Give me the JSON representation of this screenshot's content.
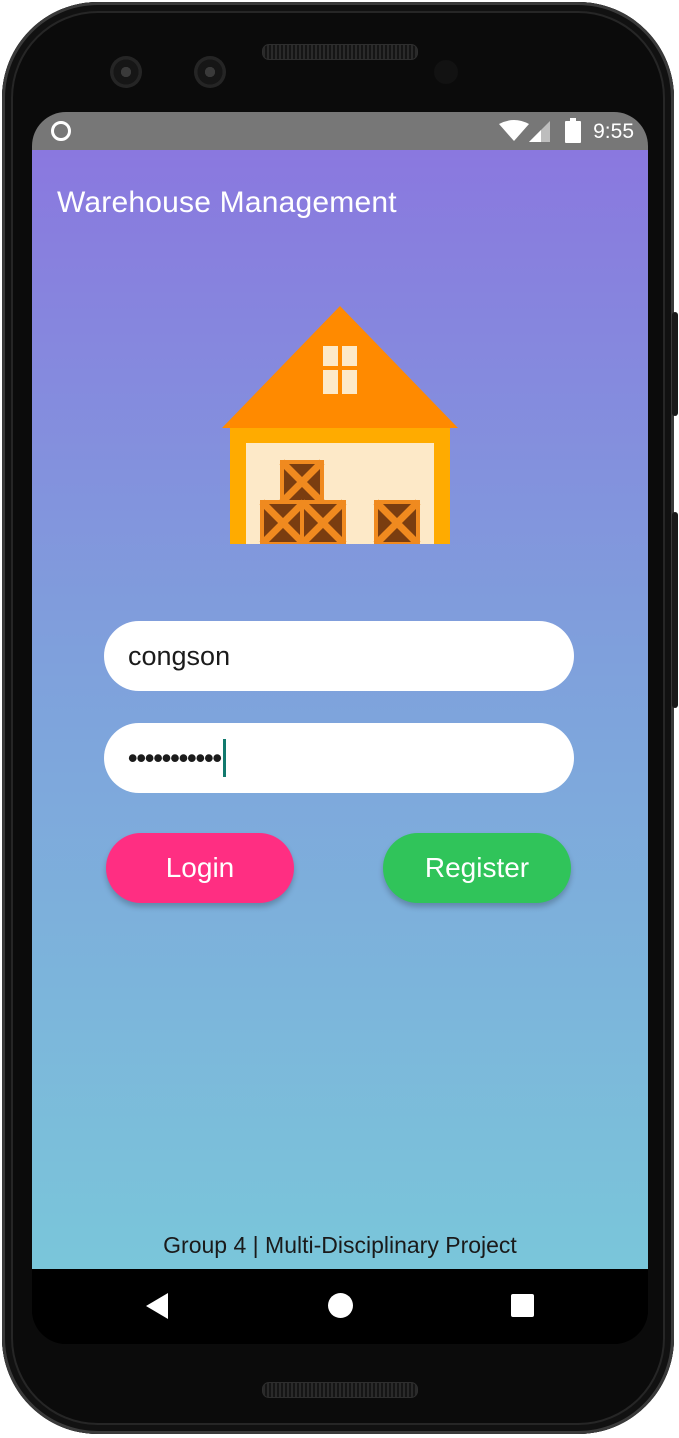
{
  "status_bar": {
    "time": "9:55",
    "icons": [
      "notification-circle-icon",
      "wifi-icon",
      "cell-signal-icon",
      "battery-icon"
    ]
  },
  "app": {
    "title": "Warehouse Management",
    "logo": "warehouse-icon",
    "background_gradient": [
      "#8a78df",
      "#7fa0dc",
      "#7ac6da"
    ]
  },
  "login_form": {
    "username_value": "congson",
    "password_masked": "•••••••••••",
    "login_label": "Login",
    "register_label": "Register"
  },
  "colors": {
    "login_button": "#ff2e82",
    "register_button": "#30c45a"
  },
  "footer": {
    "text": "Group 4 | Multi-Disciplinary Project"
  },
  "nav_bar": {
    "icons": [
      "back-icon",
      "home-icon",
      "recent-apps-icon"
    ]
  }
}
